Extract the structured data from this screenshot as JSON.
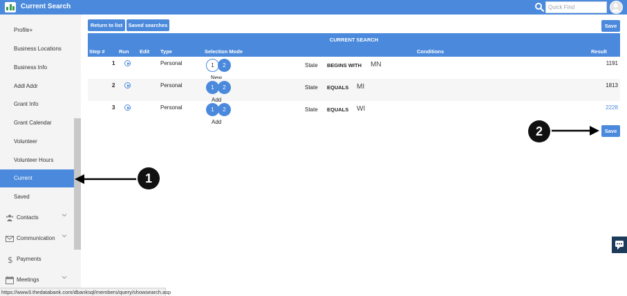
{
  "header": {
    "title": "Current Search",
    "quick_find_placeholder": "Quick Find",
    "brand_color": "#4a89dc"
  },
  "sidebar": {
    "items": [
      {
        "label": "Profile+"
      },
      {
        "label": "Business Locations"
      },
      {
        "label": "Business Info"
      },
      {
        "label": "Addl Addr"
      },
      {
        "label": "Grant Info"
      },
      {
        "label": "Grant Calendar"
      },
      {
        "label": "Volunteer"
      },
      {
        "label": "Volunteer Hours"
      },
      {
        "label": "Current",
        "active": true
      },
      {
        "label": "Saved"
      }
    ],
    "groups": [
      {
        "label": "Contacts",
        "icon": "users-icon"
      },
      {
        "label": "Communication",
        "icon": "envelope-icon"
      },
      {
        "label": "Payments",
        "icon": "dollar-icon"
      },
      {
        "label": "Meetings",
        "icon": "calendar-icon"
      }
    ]
  },
  "toolbar": {
    "return_label": "Return to list",
    "saved_searches_label": "Saved searches",
    "save_label": "Save"
  },
  "table": {
    "title": "CURRENT SEARCH",
    "columns": {
      "step": "Step #",
      "run": "Run",
      "edit": "Edit",
      "type": "Type",
      "selection_mode": "Selection Mode",
      "conditions": "Conditions",
      "result": "Result"
    },
    "rows": [
      {
        "step": "1",
        "type": "Personal",
        "opt1": "1",
        "opt2": "2",
        "mode": "New",
        "field": "State",
        "operator": "BEGINS WITH",
        "value": "MN",
        "result": "1191"
      },
      {
        "step": "2",
        "type": "Personal",
        "opt1": "1",
        "opt2": "2",
        "mode": "Add",
        "field": "State",
        "operator": "EQUALS",
        "value": "MI",
        "result": "1813"
      },
      {
        "step": "3",
        "type": "Personal",
        "opt1": "1",
        "opt2": "2",
        "mode": "Add",
        "field": "State",
        "operator": "EQUALS",
        "value": "WI",
        "result": "2228"
      }
    ]
  },
  "annotations": {
    "callout_1": "1",
    "callout_2": "2"
  },
  "status_bar": {
    "url": "https://www3.thedatabank.com/dbanksql/members/query/showsearch.asp"
  }
}
